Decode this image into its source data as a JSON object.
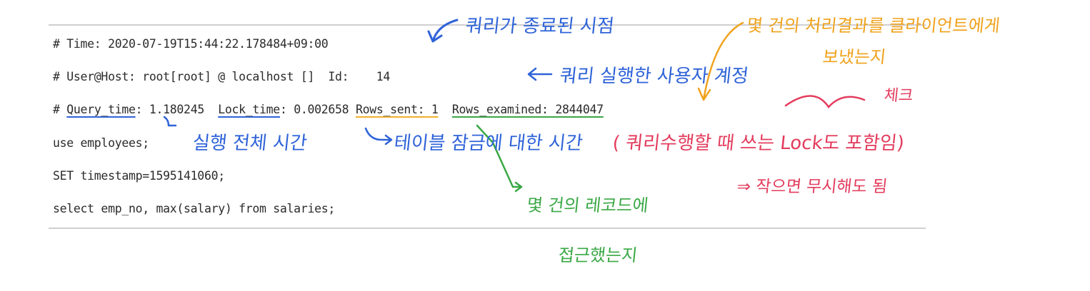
{
  "log": {
    "time_line": "# Time: 2020-07-19T15:44:22.178484+09:00",
    "userhost_line": "# User@Host: root[root] @ localhost []  Id:    14",
    "query_prefix": "# ",
    "query_time_label": "Query_time",
    "query_time_value": ": 1.180245  ",
    "lock_time_label": "Lock_time",
    "lock_time_value": ": 0.002658 ",
    "rows_sent": "Rows_sent: 1",
    "rows_sep": "  ",
    "rows_examined": "Rows_examined: 2844047",
    "use_line": "use employees;",
    "set_line": "SET timestamp=1595141060;",
    "select_line": "select emp_no, max(salary) from salaries;"
  },
  "annotations": {
    "query_end_time": "쿼리가 종료된 시점",
    "rows_sent_line1": "몇 건의 처리결과를 클라이언트에게",
    "rows_sent_line2": "보냈는지",
    "user_account": "쿼리 실행한 사용자 계정",
    "check": "체크",
    "total_time": "실행 전체 시간",
    "table_lock_time": "테이블 잠금에 대한 시간",
    "lock_note": "( 쿼리수행할 때 쓰는 Lock도 포함임)",
    "ignore_note": "⇒ 작으면 무시해도 됨",
    "rows_examined_line1": "몇 건의 레코드에",
    "rows_examined_line2": "접근했는지"
  },
  "colors": {
    "blue": "#2f63d8",
    "red": "#e33c5d",
    "green": "#3aa845",
    "orange": "#f0a21d"
  }
}
